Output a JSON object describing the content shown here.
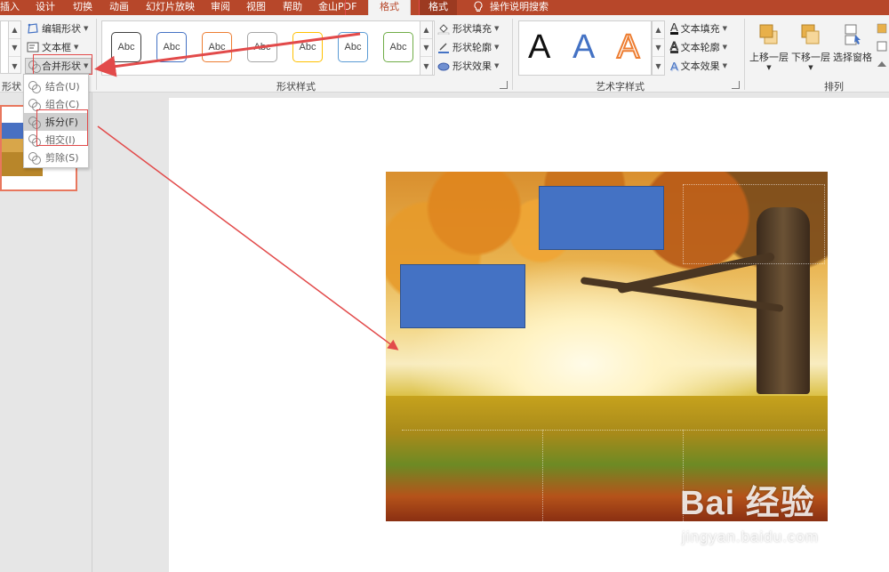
{
  "tabs": {
    "insert": "插入",
    "design": "设计",
    "transitions": "切换",
    "animations": "动画",
    "slideshow": "幻灯片放映",
    "review": "审阅",
    "view": "视图",
    "help": "帮助",
    "wps_pdf": "金山PDF",
    "format_active": "格式",
    "format_ctx": "格式",
    "tell_me": "操作说明搜索"
  },
  "ribbon": {
    "insert_shapes_group": {
      "label": "形状",
      "edit_shape": "编辑形状",
      "text_box": "文本框",
      "merge_shapes": "合并形状"
    },
    "shape_styles_group": {
      "label": "形状样式",
      "thumb_text": "Abc",
      "thumbs": [
        {
          "color": "#404040"
        },
        {
          "color": "#4472c4"
        },
        {
          "color": "#ed7d31"
        },
        {
          "color": "#a5a5a5"
        },
        {
          "color": "#ffc000"
        },
        {
          "color": "#5b9bd5"
        },
        {
          "color": "#70ad47"
        }
      ],
      "fill": "形状填充",
      "outline": "形状轮廓",
      "effects": "形状效果"
    },
    "wordart_group": {
      "label": "艺术字样式",
      "letter": "A",
      "text_fill": "文本填充",
      "text_outline": "文本轮廓",
      "text_effects": "文本效果"
    },
    "arrange_group": {
      "label": "排列",
      "bring_forward": "上移一层",
      "send_backward": "下移一层",
      "selection_pane": "选择窗格"
    }
  },
  "merge_menu": {
    "items": [
      {
        "label": "结合(U)",
        "highlighted": false
      },
      {
        "label": "组合(C)",
        "highlighted": false
      },
      {
        "label": "拆分(F)",
        "highlighted": true
      },
      {
        "label": "相交(I)",
        "highlighted": false
      },
      {
        "label": "剪除(S)",
        "highlighted": false
      }
    ]
  },
  "colors": {
    "accent": "#b7472a",
    "shape_blue": "#4472c4",
    "annotation_red": "#e24a4a"
  },
  "watermark": {
    "logo": "Bai 经验",
    "url": "jingyan.baidu.com"
  }
}
